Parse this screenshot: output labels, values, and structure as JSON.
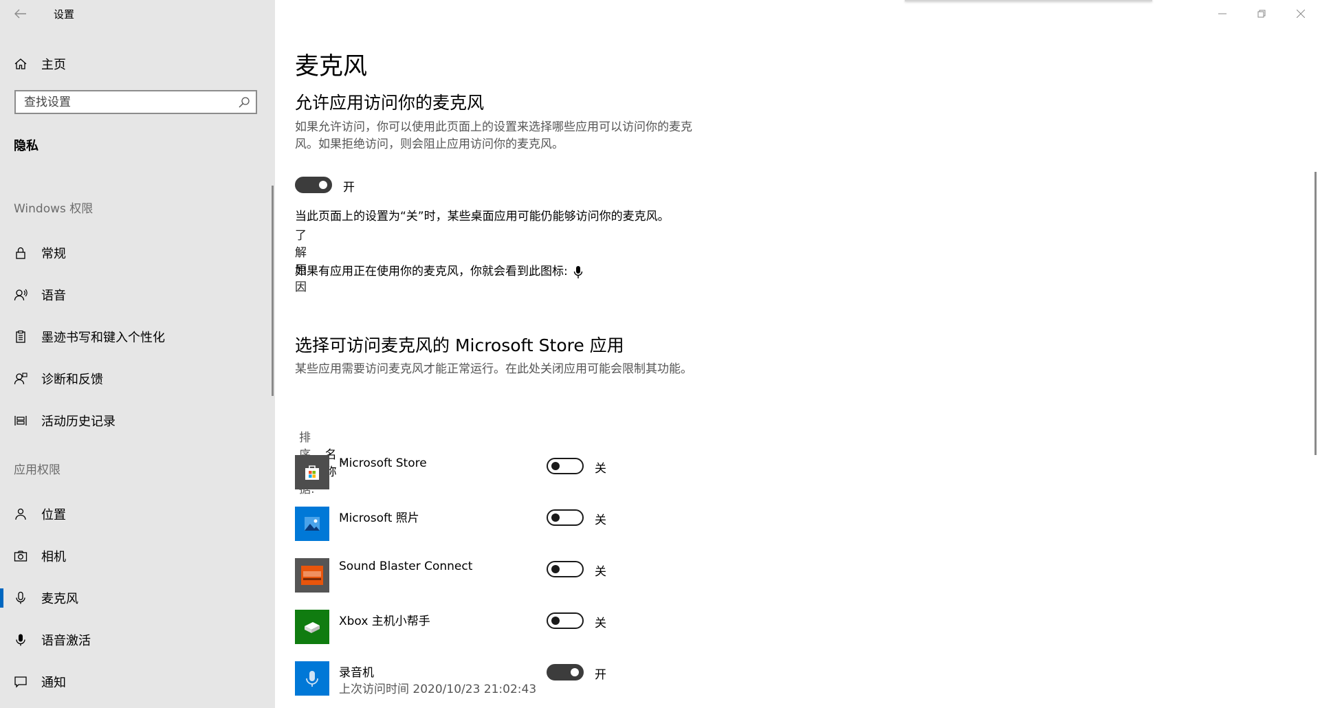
{
  "window": {
    "title": "设置"
  },
  "sidebar": {
    "home_label": "主页",
    "search_placeholder": "查找设置",
    "group_title": "隐私",
    "section_windows": "Windows 权限",
    "windows_items": [
      {
        "label": "常规",
        "icon": "lock-icon"
      },
      {
        "label": "语音",
        "icon": "speech-icon"
      },
      {
        "label": "墨迹书写和键入个性化",
        "icon": "clipboard-icon"
      },
      {
        "label": "诊断和反馈",
        "icon": "feedback-icon"
      },
      {
        "label": "活动历史记录",
        "icon": "history-icon"
      }
    ],
    "section_apps": "应用权限",
    "app_items": [
      {
        "label": "位置",
        "icon": "person-pin-icon"
      },
      {
        "label": "相机",
        "icon": "camera-icon"
      },
      {
        "label": "麦克风",
        "icon": "microphone-icon",
        "active": true
      },
      {
        "label": "语音激活",
        "icon": "voice-activation-icon"
      },
      {
        "label": "通知",
        "icon": "notification-icon"
      }
    ]
  },
  "main": {
    "title": "麦克风",
    "allow_heading": "允许应用访问你的麦克风",
    "allow_desc": "如果允许访问，你可以使用此页面上的设置来选择哪些应用可以访问你的麦克风。如果拒绝访问，则会阻止应用访问你的麦克风。",
    "master_toggle_state": "开",
    "desktop_note": "当此页面上的设置为“关”时，某些桌面应用可能仍能够访问你的麦克风。",
    "learn_more": "了解原因",
    "icon_note": "如果有应用正在使用你的麦克风，你就会看到此图标:",
    "store_heading": "选择可访问麦克风的 Microsoft Store 应用",
    "store_desc": "某些应用需要访问麦克风才能正常运行。在此处关闭应用可能会限制其功能。",
    "sort_label": "排序依据:",
    "sort_value": "名称",
    "apps": [
      {
        "name": "Microsoft Store",
        "sub": "",
        "state": "关",
        "on": false,
        "icon": "store-bag-icon",
        "color": "#4d4d4d"
      },
      {
        "name": "Microsoft 照片",
        "sub": "",
        "state": "关",
        "on": false,
        "icon": "photos-icon",
        "color": "#0078d7"
      },
      {
        "name": "Sound Blaster Connect",
        "sub": "",
        "state": "关",
        "on": false,
        "icon": "sound-blaster-icon",
        "color": "#e8550c"
      },
      {
        "name": "Xbox 主机小帮手",
        "sub": "",
        "state": "关",
        "on": false,
        "icon": "xbox-icon",
        "color": "#107c10"
      },
      {
        "name": "录音机",
        "sub": "上次访问时间 2020/10/23 21:02:43",
        "state": "开",
        "on": true,
        "icon": "voice-recorder-icon",
        "color": "#0078d7"
      }
    ]
  }
}
